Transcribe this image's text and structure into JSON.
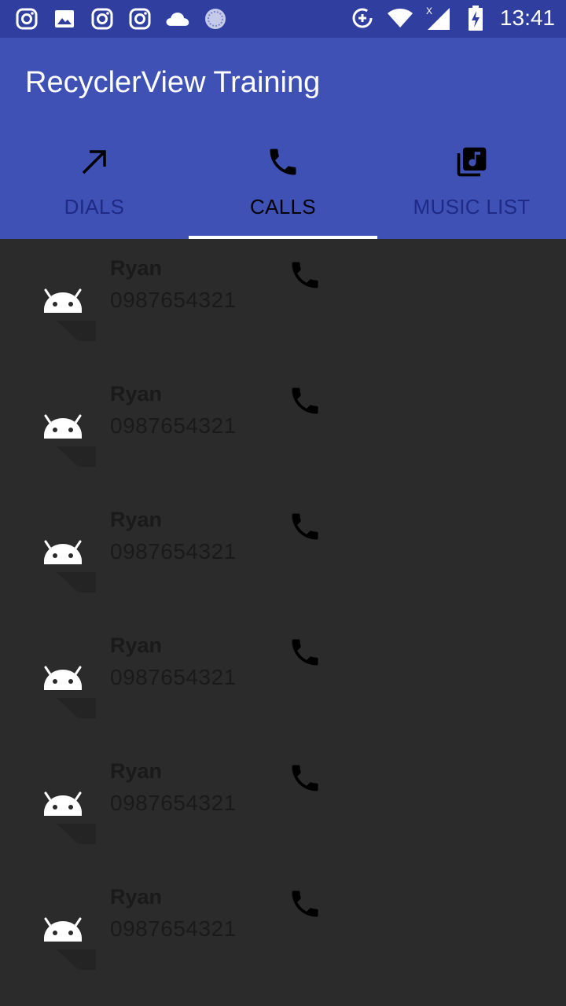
{
  "status_bar": {
    "time": "13:41",
    "left_icons": [
      "instagram-icon",
      "image-icon",
      "instagram-icon",
      "instagram-icon",
      "cloud-icon",
      "sync-circle-icon"
    ],
    "right_icons": [
      "data-saver-icon",
      "wifi-icon",
      "signal-icon",
      "battery-charging-icon"
    ]
  },
  "app_bar": {
    "title": "RecyclerView Training",
    "color": "#3f51b5"
  },
  "tabs": [
    {
      "label": "DIALS",
      "icon": "call-made-icon",
      "active": false
    },
    {
      "label": "CALLS",
      "icon": "phone-icon",
      "active": true
    },
    {
      "label": "MUSIC LIST",
      "icon": "library-music-icon",
      "active": false
    }
  ],
  "contacts": [
    {
      "name": "Ryan",
      "phone": "0987654321"
    },
    {
      "name": "Ryan",
      "phone": "0987654321"
    },
    {
      "name": "Ryan",
      "phone": "0987654321"
    },
    {
      "name": "Ryan",
      "phone": "0987654321"
    },
    {
      "name": "Ryan",
      "phone": "0987654321"
    },
    {
      "name": "Ryan",
      "phone": "0987654321"
    }
  ]
}
